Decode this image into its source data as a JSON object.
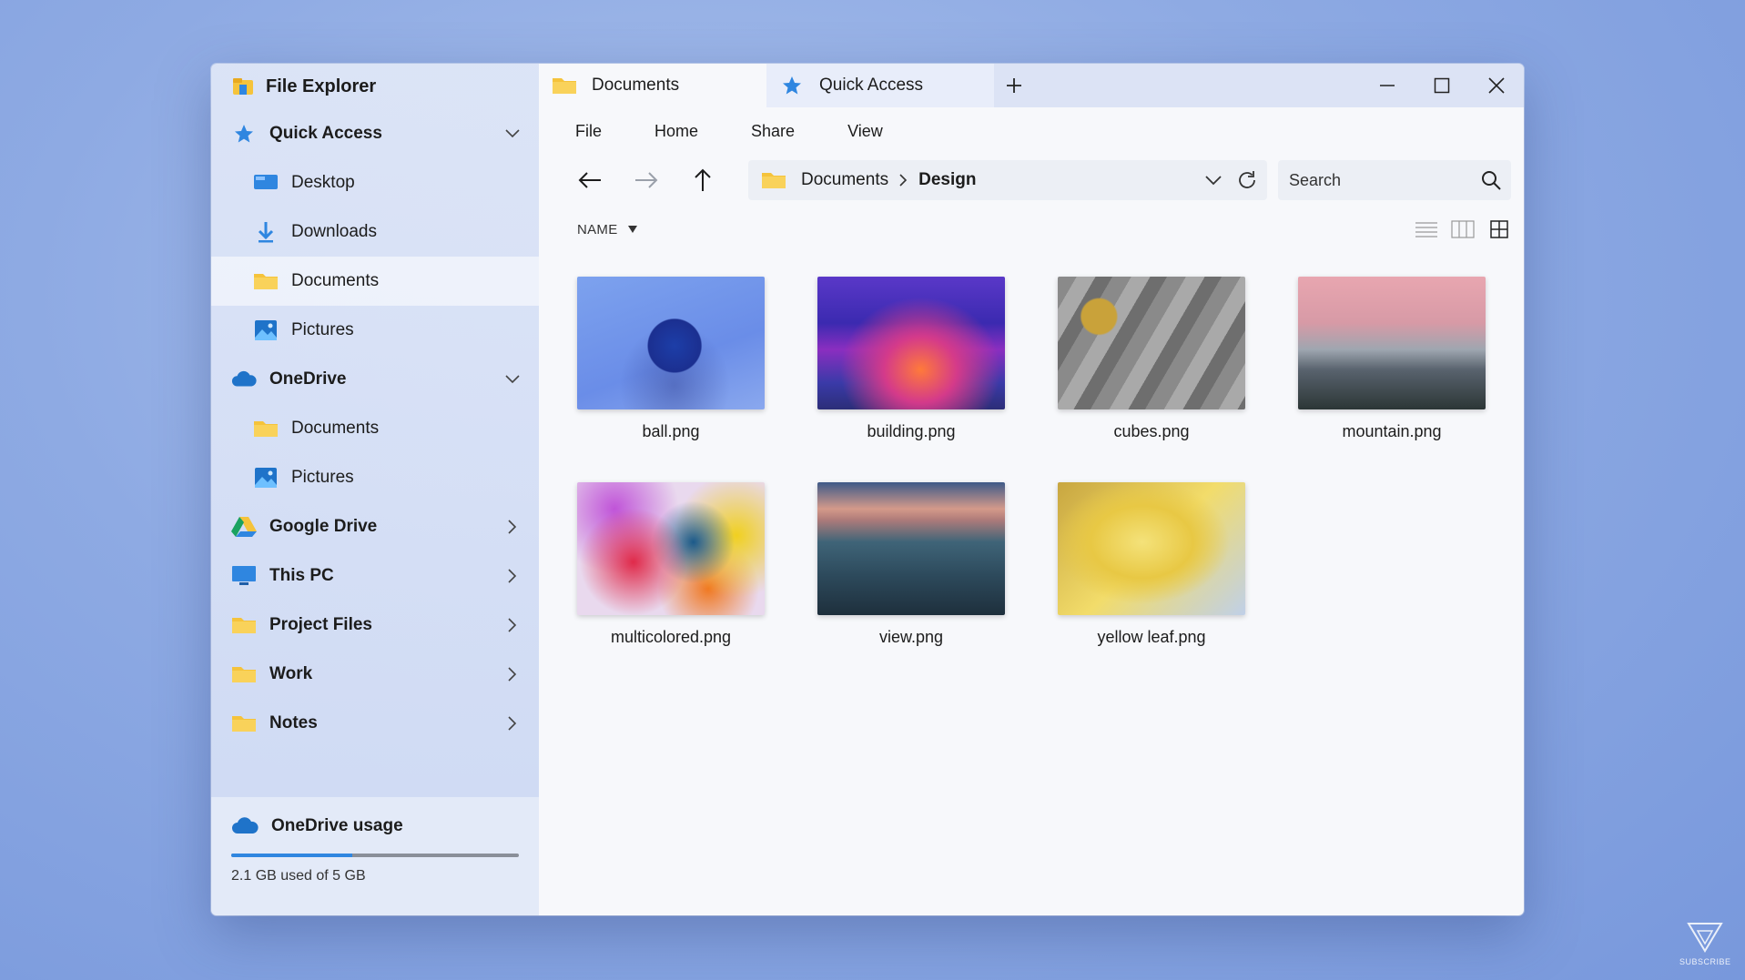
{
  "app": {
    "title": "File Explorer"
  },
  "sidebar": {
    "items": [
      {
        "label": "Quick Access"
      },
      {
        "label": "Desktop"
      },
      {
        "label": "Downloads"
      },
      {
        "label": "Documents"
      },
      {
        "label": "Pictures"
      },
      {
        "label": "OneDrive"
      },
      {
        "label": "Documents"
      },
      {
        "label": "Pictures"
      },
      {
        "label": "Google Drive"
      },
      {
        "label": "This PC"
      },
      {
        "label": "Project Files"
      },
      {
        "label": "Work"
      },
      {
        "label": "Notes"
      }
    ],
    "usage": {
      "title": "OneDrive usage",
      "text": "2.1 GB used of 5 GB",
      "fraction": 0.42
    }
  },
  "tabs": [
    {
      "label": "Documents"
    },
    {
      "label": "Quick Access"
    }
  ],
  "menu": [
    "File",
    "Home",
    "Share",
    "View"
  ],
  "address": {
    "crumbs": [
      "Documents",
      "Design"
    ]
  },
  "search": {
    "placeholder": "Search"
  },
  "sort": {
    "label": "NAME"
  },
  "files": [
    {
      "name": "ball.png"
    },
    {
      "name": "building.png"
    },
    {
      "name": "cubes.png"
    },
    {
      "name": "mountain.png"
    },
    {
      "name": "multicolored.png"
    },
    {
      "name": "view.png"
    },
    {
      "name": "yellow leaf.png"
    }
  ],
  "colors": {
    "accent": "#2f86e0",
    "folder": "#f5c33b"
  },
  "brand": {
    "text": "SUBSCRIBE"
  }
}
